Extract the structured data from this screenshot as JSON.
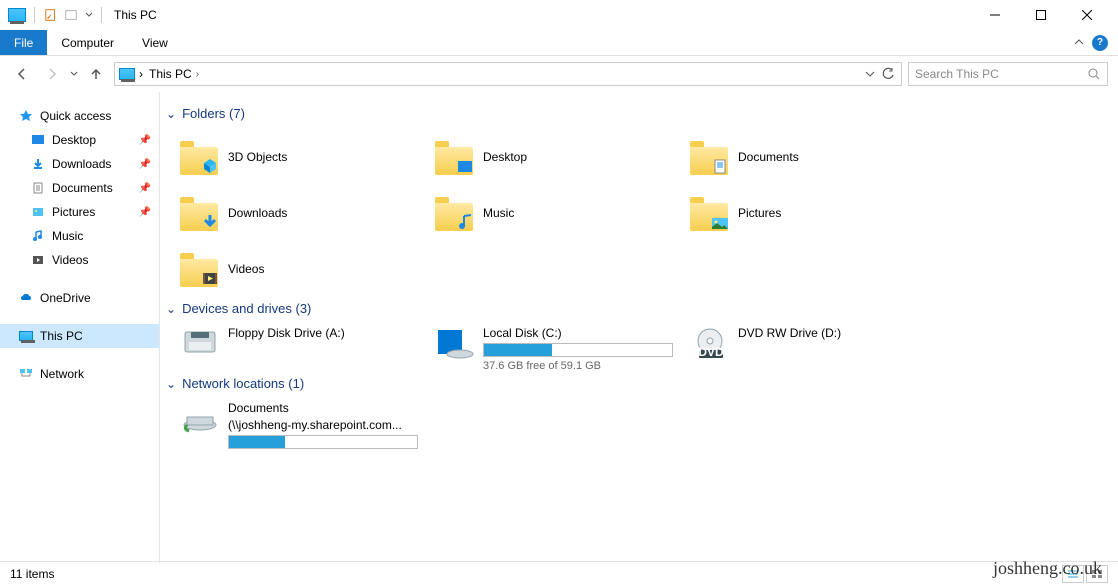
{
  "title": "This PC",
  "ribbon": {
    "file": "File",
    "computer": "Computer",
    "view": "View"
  },
  "address": {
    "root": "This PC"
  },
  "search": {
    "placeholder": "Search This PC"
  },
  "sidebar": {
    "quick": {
      "label": "Quick access",
      "items": [
        {
          "label": "Desktop",
          "pinned": true
        },
        {
          "label": "Downloads",
          "pinned": true
        },
        {
          "label": "Documents",
          "pinned": true
        },
        {
          "label": "Pictures",
          "pinned": true
        },
        {
          "label": "Music",
          "pinned": false
        },
        {
          "label": "Videos",
          "pinned": false
        }
      ]
    },
    "onedrive": "OneDrive",
    "thispc": "This PC",
    "network": "Network"
  },
  "sections": {
    "folders": {
      "label": "Folders (7)",
      "items": [
        "3D Objects",
        "Desktop",
        "Documents",
        "Downloads",
        "Music",
        "Pictures",
        "Videos"
      ]
    },
    "drives": {
      "label": "Devices and drives (3)",
      "items": [
        {
          "label": "Floppy Disk Drive (A:)",
          "type": "floppy"
        },
        {
          "label": "Local Disk (C:)",
          "type": "local",
          "free": "37.6 GB free of 59.1 GB",
          "fill": 36
        },
        {
          "label": "DVD RW Drive (D:)",
          "type": "dvd"
        }
      ]
    },
    "network": {
      "label": "Network locations (1)",
      "items": [
        {
          "label": "Documents",
          "sub": "(\\\\joshheng-my.sharepoint.com...",
          "fill": 30
        }
      ]
    }
  },
  "status": {
    "count": "11 items"
  },
  "watermark": "joshheng.co.uk"
}
